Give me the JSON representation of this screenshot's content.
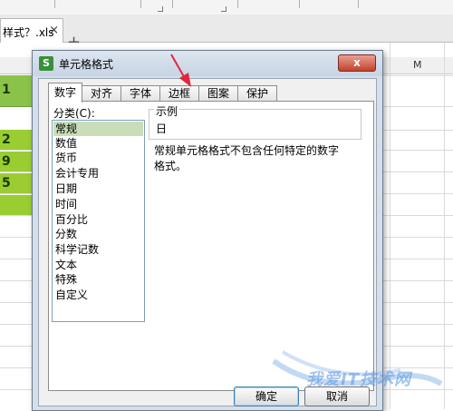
{
  "document_tab": {
    "name": "样式？.xls",
    "close_glyph": "×",
    "add_glyph": "+"
  },
  "sheet": {
    "column_header_m": "M",
    "cells": [
      "1",
      "2",
      "9",
      "5"
    ]
  },
  "dialog": {
    "app_icon_letter": "S",
    "title": "单元格格式",
    "close_glyph": "x",
    "tabs": [
      {
        "label": "数字",
        "active": true
      },
      {
        "label": "对齐",
        "active": false
      },
      {
        "label": "字体",
        "active": false
      },
      {
        "label": "边框",
        "active": false
      },
      {
        "label": "图案",
        "active": false
      },
      {
        "label": "保护",
        "active": false
      }
    ],
    "category_label": "分类(C):",
    "categories": [
      "常规",
      "数值",
      "货币",
      "会计专用",
      "日期",
      "时间",
      "百分比",
      "分数",
      "科学记数",
      "文本",
      "特殊",
      "自定义"
    ],
    "selected_category": "常规",
    "sample_label": "示例",
    "sample_value": "日",
    "description": "常规单元格格式不包含任何特定的数字格式。",
    "ok_label": "确定",
    "cancel_label": "取消"
  },
  "watermark": {
    "text": "我爱IT技术网"
  },
  "colors": {
    "accent_green": "#8bc34a",
    "selected_item": "#c8ddb8",
    "close_red": "#c4412c",
    "annotation_arrow": "#e0283a"
  }
}
